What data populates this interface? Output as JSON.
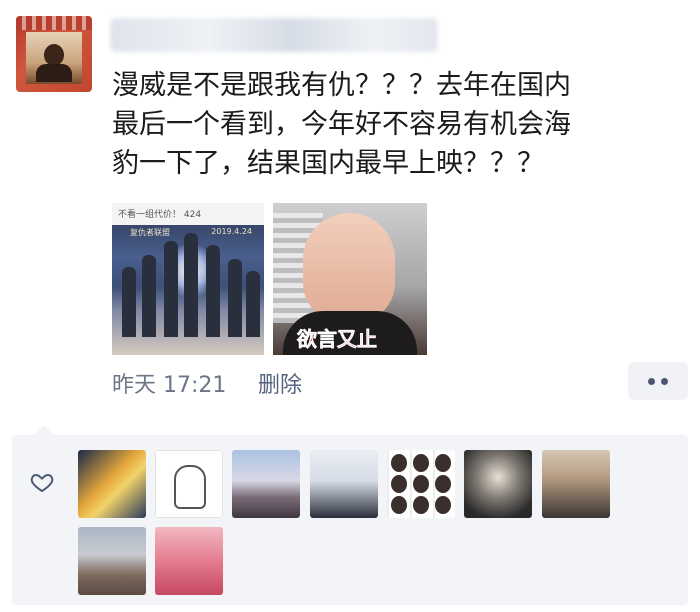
{
  "post": {
    "text": "漫威是不是跟我有仇？？？去年在国内\n最后一个看到，今年好不容易有机会海\n豹一下了，结果国内最早上映？？？",
    "time": "昨天 17:21",
    "delete_label": "删除"
  },
  "images": {
    "poster_topbar": "不看一组代价！ 424",
    "poster_title_left": "复仇者联盟",
    "poster_title_right": "2019.4.24",
    "meme_caption": "欲言又止"
  },
  "icons": {
    "more": "more-dots-icon",
    "like": "heart-icon"
  },
  "likes": {
    "avatars": [
      "liker-avatar-1",
      "liker-avatar-2",
      "liker-avatar-3",
      "liker-avatar-4",
      "liker-avatar-5",
      "liker-avatar-6",
      "liker-avatar-7",
      "liker-avatar-8",
      "liker-avatar-9"
    ]
  },
  "colors": {
    "meta_text": "#6d7688",
    "delete_link": "#55637f",
    "panel_bg": "#f3f4f7"
  }
}
